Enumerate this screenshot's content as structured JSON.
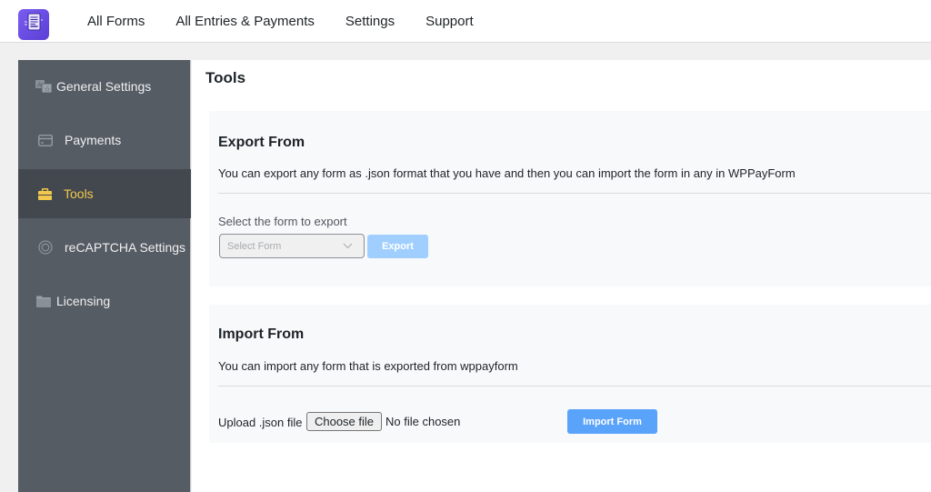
{
  "app": {
    "logo_icon": "document-form-icon",
    "brand_color": "#6a4ee3"
  },
  "nav": {
    "items": [
      {
        "label": "All Forms"
      },
      {
        "label": "All Entries & Payments"
      },
      {
        "label": "Settings"
      },
      {
        "label": "Support"
      }
    ]
  },
  "sidebar": {
    "items": [
      {
        "label": "General Settings",
        "icon": "translate-icon",
        "active": false
      },
      {
        "label": "Payments",
        "icon": "credit-card-icon",
        "active": false
      },
      {
        "label": "Tools",
        "icon": "briefcase-icon",
        "active": true
      },
      {
        "label": "reCAPTCHA Settings",
        "icon": "lifebuoy-icon",
        "active": false
      },
      {
        "label": "Licensing",
        "icon": "folder-icon",
        "active": false
      }
    ],
    "active_color": "#f2c94c"
  },
  "main": {
    "title": "Tools",
    "export": {
      "title": "Export From",
      "description": "You can export any form as .json format that you have and then you can import the form in any in WPPayForm",
      "select_label": "Select the form to export",
      "select_placeholder": "Select Form",
      "button_label": "Export"
    },
    "import": {
      "title": "Import From",
      "description": "You can import any form that is exported from wppayform",
      "upload_label": "Upload .json file",
      "choose_file_label": "Choose file",
      "no_file_text": "No file chosen",
      "button_label": "Import Form"
    }
  }
}
